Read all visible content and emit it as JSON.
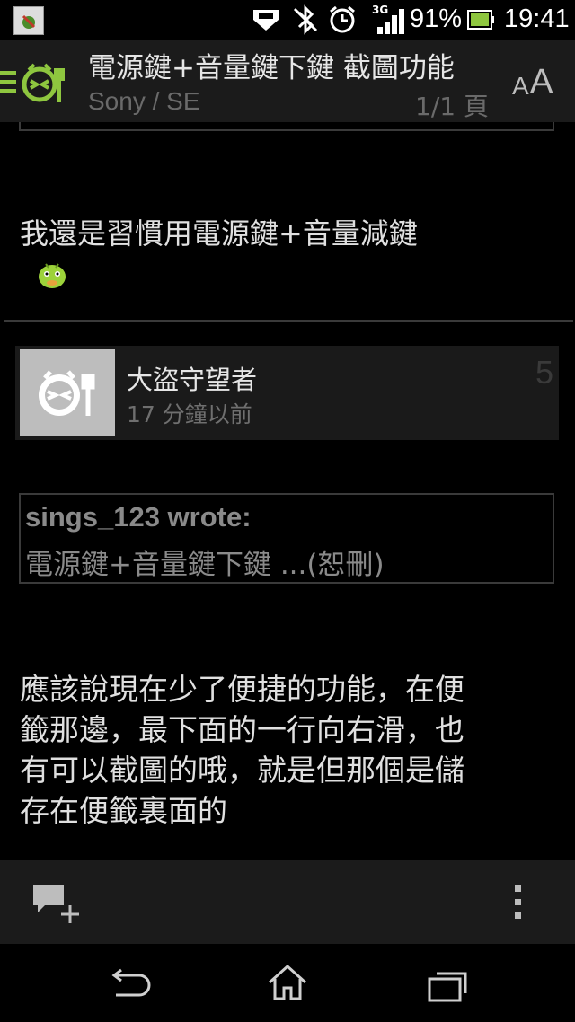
{
  "status_bar": {
    "network": "3G",
    "battery": "91%",
    "time": "19:41"
  },
  "action_bar": {
    "title": "電源鍵+音量鍵下鍵 截圖功能",
    "forum": "Sony / SE",
    "page_indicator": "1/1 頁",
    "font_size_button": "AA"
  },
  "post_prev": {
    "text": "我還是習慣用電源鍵+音量減鍵"
  },
  "post": {
    "author": "大盜守望者",
    "time": "17 分鐘以前",
    "floor": "5",
    "quote": {
      "author": "sings_123 wrote:",
      "text": "電源鍵+音量鍵下鍵 ...(恕刪)"
    },
    "body_lines": [
      "應該說現在少了便捷的功能，在便",
      "籤那邊，最下面的一行向右滑，也",
      "有可以截圖的哦，就是但那個是儲",
      "存在便籤裏面的"
    ]
  },
  "colors": {
    "accent_green": "#8ec63f",
    "background": "#000000",
    "bar": "#1b1b1b"
  },
  "icons": {
    "status": [
      "app-notification-icon",
      "car-mode-icon",
      "bluetooth-off-icon",
      "alarm-icon",
      "signal-icon",
      "battery-icon"
    ],
    "action_bar": [
      "app-logo-icon"
    ],
    "bottom": [
      "reply-icon",
      "overflow-menu-icon"
    ],
    "nav": [
      "back-icon",
      "home-icon",
      "recent-apps-icon"
    ]
  }
}
